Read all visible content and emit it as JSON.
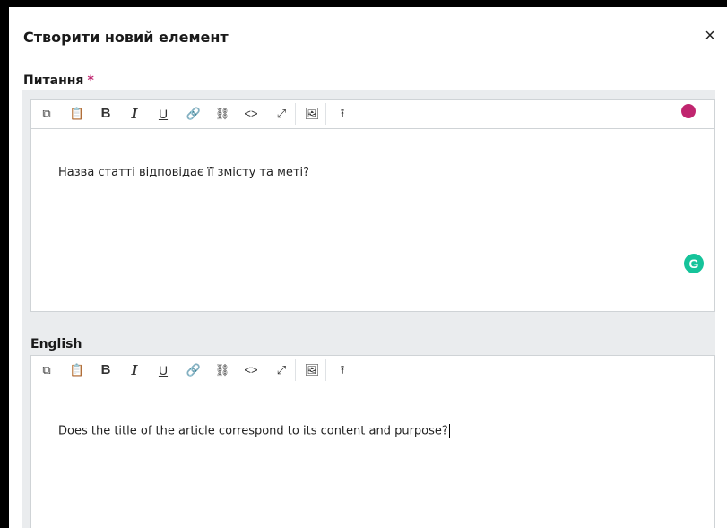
{
  "modal": {
    "title": "Створити новий елемент",
    "close_label": "×"
  },
  "question_field": {
    "label": "Питання",
    "required_mark": "*",
    "content": "Назва статті відповідає її змісту та меті?"
  },
  "english_field": {
    "label": "English",
    "content": "Does the title of the article correspond to its content and purpose?"
  },
  "toolbar": {
    "copy": "⧉",
    "paste": "📋",
    "bold": "B",
    "italic": "I",
    "underline": "U",
    "link": "🔗",
    "unlink": "⛓",
    "code": "<>",
    "fullscreen": "⤢",
    "image": "🖼",
    "upload": "⭱",
    "icons": [
      "copy-icon",
      "paste-icon",
      "bold-icon",
      "italic-icon",
      "underline-icon",
      "link-icon",
      "unlink-icon",
      "code-icon",
      "fullscreen-icon",
      "image-icon",
      "upload-icon"
    ]
  },
  "colors": {
    "accent": "#c0256f",
    "grammarly": "#15c39a"
  }
}
